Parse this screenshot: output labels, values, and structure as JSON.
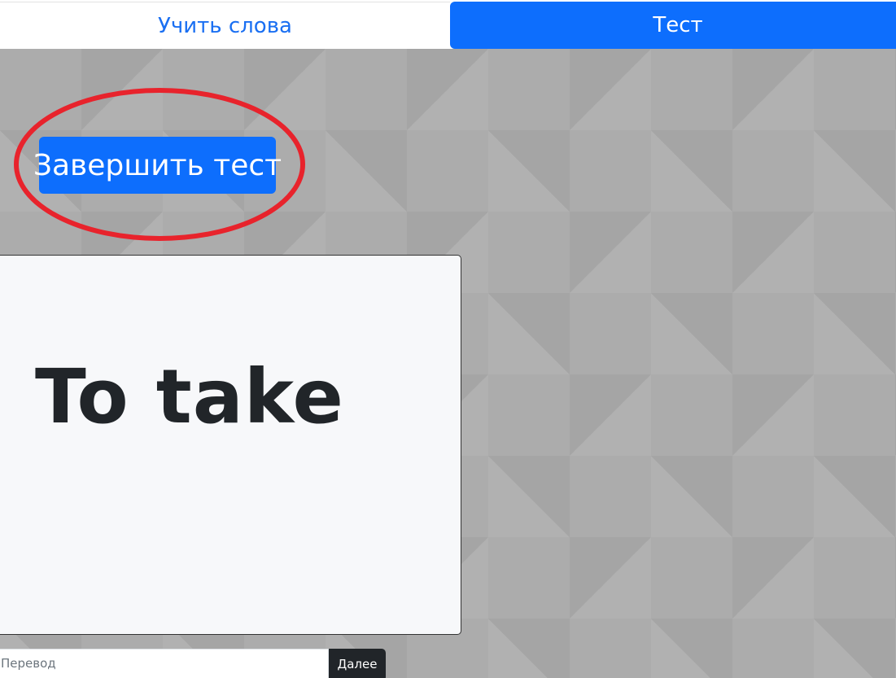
{
  "nav": {
    "tabs": [
      {
        "label": "Учить слова",
        "active": false
      },
      {
        "label": "Тест",
        "active": true
      }
    ]
  },
  "test": {
    "finish_label": "Завершить тест",
    "word": "To take",
    "answer_placeholder": "Перевод",
    "answer_value": "",
    "next_label": "Далее"
  },
  "colors": {
    "accent": "#0d6efd",
    "link": "#1a6ff2",
    "annotation": "#e8232c",
    "dark_button": "#212529",
    "card_bg": "#f7f8fa",
    "page_bg": "#acacac"
  }
}
